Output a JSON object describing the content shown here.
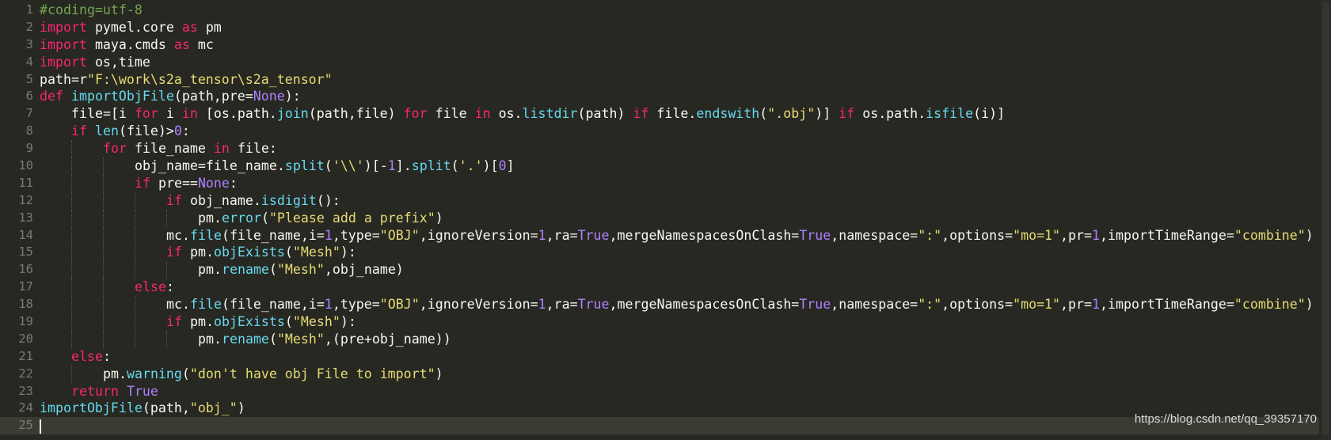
{
  "editor": {
    "theme_colors": {
      "background": "#272822",
      "keyword": "#f92672",
      "string": "#e6db74",
      "function": "#66d9ef",
      "number": "#ae81ff",
      "comment": "#75a550",
      "text": "#f8f8f2",
      "line_number": "#7a7a72"
    },
    "current_line": 25,
    "lines": [
      {
        "n": "1",
        "indent": 0,
        "tokens": [
          [
            "cm",
            "#coding=utf-8"
          ]
        ]
      },
      {
        "n": "2",
        "indent": 0,
        "tokens": [
          [
            "kw",
            "import"
          ],
          [
            "pl",
            " pymel.core "
          ],
          [
            "kw",
            "as"
          ],
          [
            "pl",
            " pm"
          ]
        ]
      },
      {
        "n": "3",
        "indent": 0,
        "tokens": [
          [
            "kw",
            "import"
          ],
          [
            "pl",
            " maya.cmds "
          ],
          [
            "kw",
            "as"
          ],
          [
            "pl",
            " mc"
          ]
        ]
      },
      {
        "n": "4",
        "indent": 0,
        "tokens": [
          [
            "kw",
            "import"
          ],
          [
            "pl",
            " os,time"
          ]
        ]
      },
      {
        "n": "5",
        "indent": 0,
        "tokens": [
          [
            "pl",
            "path=r"
          ],
          [
            "st",
            "\"F:\\work\\s2a_tensor\\s2a_tensor\""
          ]
        ]
      },
      {
        "n": "6",
        "indent": 0,
        "tokens": [
          [
            "kw",
            "def"
          ],
          [
            "pl",
            " "
          ],
          [
            "fn",
            "importObjFile"
          ],
          [
            "pl",
            "(path,pre="
          ],
          [
            "nm",
            "None"
          ],
          [
            "pl",
            "):"
          ]
        ]
      },
      {
        "n": "7",
        "indent": 1,
        "tokens": [
          [
            "pl",
            "file=[i "
          ],
          [
            "kw",
            "for"
          ],
          [
            "pl",
            " i "
          ],
          [
            "kw",
            "in"
          ],
          [
            "pl",
            " [os.path."
          ],
          [
            "fn",
            "join"
          ],
          [
            "pl",
            "(path,file) "
          ],
          [
            "kw",
            "for"
          ],
          [
            "pl",
            " file "
          ],
          [
            "kw",
            "in"
          ],
          [
            "pl",
            " os."
          ],
          [
            "fn",
            "listdir"
          ],
          [
            "pl",
            "(path) "
          ],
          [
            "kw",
            "if"
          ],
          [
            "pl",
            " file."
          ],
          [
            "fn",
            "endswith"
          ],
          [
            "pl",
            "("
          ],
          [
            "st",
            "\".obj\""
          ],
          [
            "pl",
            ")] "
          ],
          [
            "kw",
            "if"
          ],
          [
            "pl",
            " os.path."
          ],
          [
            "fn",
            "isfile"
          ],
          [
            "pl",
            "(i)]"
          ]
        ]
      },
      {
        "n": "8",
        "indent": 1,
        "tokens": [
          [
            "kw",
            "if"
          ],
          [
            "pl",
            " "
          ],
          [
            "fn",
            "len"
          ],
          [
            "pl",
            "(file)>"
          ],
          [
            "nm",
            "0"
          ],
          [
            "pl",
            ":"
          ]
        ]
      },
      {
        "n": "9",
        "indent": 2,
        "tokens": [
          [
            "kw",
            "for"
          ],
          [
            "pl",
            " file_name "
          ],
          [
            "kw",
            "in"
          ],
          [
            "pl",
            " file:"
          ]
        ]
      },
      {
        "n": "10",
        "indent": 3,
        "tokens": [
          [
            "pl",
            "obj_name=file_name."
          ],
          [
            "fn",
            "split"
          ],
          [
            "pl",
            "("
          ],
          [
            "st",
            "'\\\\'"
          ],
          [
            "pl",
            ")[-"
          ],
          [
            "nm",
            "1"
          ],
          [
            "pl",
            "]."
          ],
          [
            "fn",
            "split"
          ],
          [
            "pl",
            "("
          ],
          [
            "st",
            "'.'"
          ],
          [
            "pl",
            ")["
          ],
          [
            "nm",
            "0"
          ],
          [
            "pl",
            "]"
          ]
        ]
      },
      {
        "n": "11",
        "indent": 3,
        "tokens": [
          [
            "kw",
            "if"
          ],
          [
            "pl",
            " pre=="
          ],
          [
            "nm",
            "None"
          ],
          [
            "pl",
            ":"
          ]
        ]
      },
      {
        "n": "12",
        "indent": 4,
        "tokens": [
          [
            "kw",
            "if"
          ],
          [
            "pl",
            " obj_name."
          ],
          [
            "fn",
            "isdigit"
          ],
          [
            "pl",
            "():"
          ]
        ]
      },
      {
        "n": "13",
        "indent": 5,
        "tokens": [
          [
            "pl",
            "pm."
          ],
          [
            "fn",
            "error"
          ],
          [
            "pl",
            "("
          ],
          [
            "st",
            "\"Please add a prefix\""
          ],
          [
            "pl",
            ")"
          ]
        ]
      },
      {
        "n": "14",
        "indent": 4,
        "tokens": [
          [
            "pl",
            "mc."
          ],
          [
            "fn",
            "file"
          ],
          [
            "pl",
            "(file_name,i="
          ],
          [
            "nm",
            "1"
          ],
          [
            "pl",
            ",type="
          ],
          [
            "st",
            "\"OBJ\""
          ],
          [
            "pl",
            ",ignoreVersion="
          ],
          [
            "nm",
            "1"
          ],
          [
            "pl",
            ",ra="
          ],
          [
            "nm",
            "True"
          ],
          [
            "pl",
            ",mergeNamespacesOnClash="
          ],
          [
            "nm",
            "True"
          ],
          [
            "pl",
            ",namespace="
          ],
          [
            "st",
            "\":\""
          ],
          [
            "pl",
            ",options="
          ],
          [
            "st",
            "\"mo=1\""
          ],
          [
            "pl",
            ",pr="
          ],
          [
            "nm",
            "1"
          ],
          [
            "pl",
            ",importTimeRange="
          ],
          [
            "st",
            "\"combine\""
          ],
          [
            "pl",
            ")"
          ]
        ]
      },
      {
        "n": "15",
        "indent": 4,
        "tokens": [
          [
            "kw",
            "if"
          ],
          [
            "pl",
            " pm."
          ],
          [
            "fn",
            "objExists"
          ],
          [
            "pl",
            "("
          ],
          [
            "st",
            "\"Mesh\""
          ],
          [
            "pl",
            "):"
          ]
        ]
      },
      {
        "n": "16",
        "indent": 5,
        "tokens": [
          [
            "pl",
            "pm."
          ],
          [
            "fn",
            "rename"
          ],
          [
            "pl",
            "("
          ],
          [
            "st",
            "\"Mesh\""
          ],
          [
            "pl",
            ",obj_name)"
          ]
        ]
      },
      {
        "n": "17",
        "indent": 3,
        "tokens": [
          [
            "kw",
            "else"
          ],
          [
            "pl",
            ":"
          ]
        ]
      },
      {
        "n": "18",
        "indent": 4,
        "tokens": [
          [
            "pl",
            "mc."
          ],
          [
            "fn",
            "file"
          ],
          [
            "pl",
            "(file_name,i="
          ],
          [
            "nm",
            "1"
          ],
          [
            "pl",
            ",type="
          ],
          [
            "st",
            "\"OBJ\""
          ],
          [
            "pl",
            ",ignoreVersion="
          ],
          [
            "nm",
            "1"
          ],
          [
            "pl",
            ",ra="
          ],
          [
            "nm",
            "True"
          ],
          [
            "pl",
            ",mergeNamespacesOnClash="
          ],
          [
            "nm",
            "True"
          ],
          [
            "pl",
            ",namespace="
          ],
          [
            "st",
            "\":\""
          ],
          [
            "pl",
            ",options="
          ],
          [
            "st",
            "\"mo=1\""
          ],
          [
            "pl",
            ",pr="
          ],
          [
            "nm",
            "1"
          ],
          [
            "pl",
            ",importTimeRange="
          ],
          [
            "st",
            "\"combine\""
          ],
          [
            "pl",
            ")"
          ]
        ]
      },
      {
        "n": "19",
        "indent": 4,
        "tokens": [
          [
            "kw",
            "if"
          ],
          [
            "pl",
            " pm."
          ],
          [
            "fn",
            "objExists"
          ],
          [
            "pl",
            "("
          ],
          [
            "st",
            "\"Mesh\""
          ],
          [
            "pl",
            "):"
          ]
        ]
      },
      {
        "n": "20",
        "indent": 5,
        "tokens": [
          [
            "pl",
            "pm."
          ],
          [
            "fn",
            "rename"
          ],
          [
            "pl",
            "("
          ],
          [
            "st",
            "\"Mesh\""
          ],
          [
            "pl",
            ",(pre+obj_name))"
          ]
        ]
      },
      {
        "n": "21",
        "indent": 1,
        "tokens": [
          [
            "kw",
            "else"
          ],
          [
            "pl",
            ":"
          ]
        ]
      },
      {
        "n": "22",
        "indent": 2,
        "tokens": [
          [
            "pl",
            "pm."
          ],
          [
            "fn",
            "warning"
          ],
          [
            "pl",
            "("
          ],
          [
            "st",
            "\"don't have obj File to import\""
          ],
          [
            "pl",
            ")"
          ]
        ]
      },
      {
        "n": "23",
        "indent": 1,
        "tokens": [
          [
            "kw",
            "return"
          ],
          [
            "pl",
            " "
          ],
          [
            "nm",
            "True"
          ]
        ]
      },
      {
        "n": "24",
        "indent": 0,
        "tokens": [
          [
            "fn",
            "importObjFile"
          ],
          [
            "pl",
            "(path,"
          ],
          [
            "st",
            "\"obj_\""
          ],
          [
            "pl",
            ")"
          ]
        ]
      },
      {
        "n": "25",
        "indent": 0,
        "tokens": []
      }
    ]
  },
  "watermark": "https://blog.csdn.net/qq_39357170"
}
